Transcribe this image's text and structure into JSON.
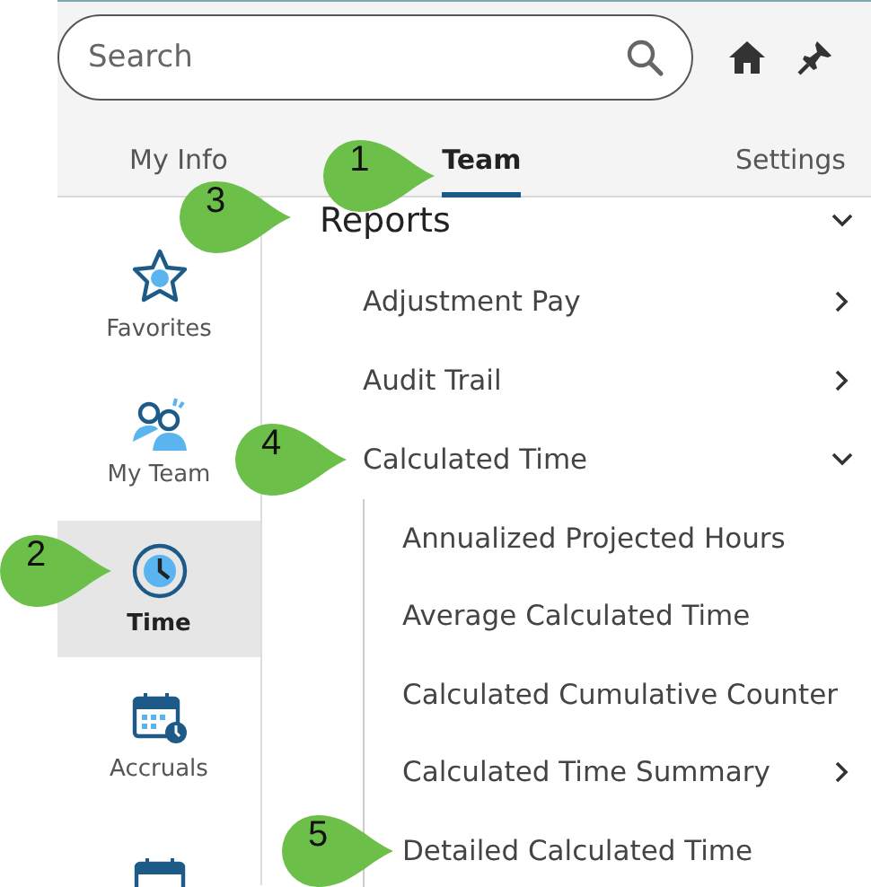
{
  "search": {
    "placeholder": "Search"
  },
  "tabs": [
    {
      "label": "My Info",
      "selected": false
    },
    {
      "label": "Team",
      "selected": true,
      "callout": "1"
    },
    {
      "label": "Settings",
      "selected": false
    }
  ],
  "sidebar": {
    "items": [
      {
        "label": "Favorites",
        "kind": "star",
        "selected": false
      },
      {
        "label": "My Team",
        "kind": "team",
        "selected": false
      },
      {
        "label": "Time",
        "kind": "clock",
        "selected": true,
        "callout": "2"
      },
      {
        "label": "Accruals",
        "kind": "accruals",
        "selected": false
      },
      {
        "kind": "calendar",
        "selected": false
      }
    ]
  },
  "section": {
    "title": "Reports",
    "expanded": true,
    "callout": "3",
    "items": [
      {
        "label": "Adjustment Pay",
        "expanded": false
      },
      {
        "label": "Audit Trail",
        "expanded": false
      },
      {
        "label": "Calculated Time",
        "expanded": true,
        "callout": "4",
        "children": [
          {
            "label": "Annualized Projected Hours"
          },
          {
            "label": "Average Calculated Time"
          },
          {
            "label": "Calculated Cumulative Counter"
          },
          {
            "label": "Calculated Time Summary",
            "expanded": false
          },
          {
            "label": "Detailed Calculated Time",
            "callout": "5"
          }
        ]
      }
    ]
  }
}
